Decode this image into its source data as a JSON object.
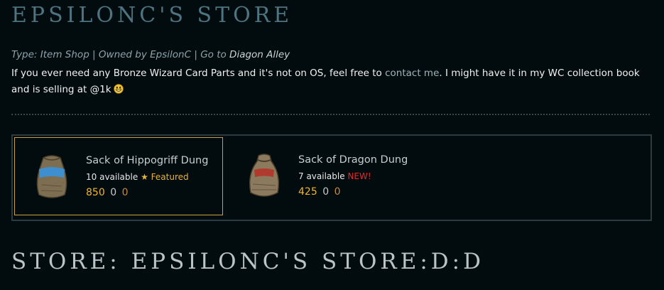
{
  "store": {
    "title": "Epsilonc's Store",
    "meta": {
      "type_prefix": "Type: ",
      "type_value": "Item Shop",
      "sep1": " | ",
      "owned_prefix": "Owned by ",
      "owner": "EpsilonC",
      "sep2": " | ",
      "goto_prefix": "Go to ",
      "goto_link": "Diagon Alley"
    },
    "description": {
      "before_link": "If you ever need any Bronze Wizard Card Parts and it's not on OS, feel free to ",
      "link": "contact me",
      "after_link": ". I might have it in my WC collection book and is selling at @1k",
      "emoji_icon": "grin-emoji"
    }
  },
  "items": [
    {
      "name": "Sack of Hippogriff Dung",
      "available": "10 available",
      "tag_icon": "star-icon",
      "tag_glyph": "★",
      "tag": "Featured",
      "price_gold": "850",
      "price_silver": "0",
      "price_bronze": "0",
      "icon": "hippogriff-dung-sack-icon",
      "sack_color": "#7d6e52",
      "label_color": "#3d8fd0"
    },
    {
      "name": "Sack of Dragon Dung",
      "available": "7 available",
      "tag": "NEW!",
      "price_gold": "425",
      "price_silver": "0",
      "price_bronze": "0",
      "icon": "dragon-dung-sack-icon",
      "sack_color": "#8c7a5e",
      "label_color": "#b03a2e"
    }
  ],
  "footer": {
    "title": "Store: Epsilonc's Store:D:D"
  },
  "colors": {
    "background": "#020b0e",
    "title": "#4d7480",
    "gold": "#f0b52e",
    "featured_border": "#c8a243",
    "new": "#e02b2b"
  }
}
